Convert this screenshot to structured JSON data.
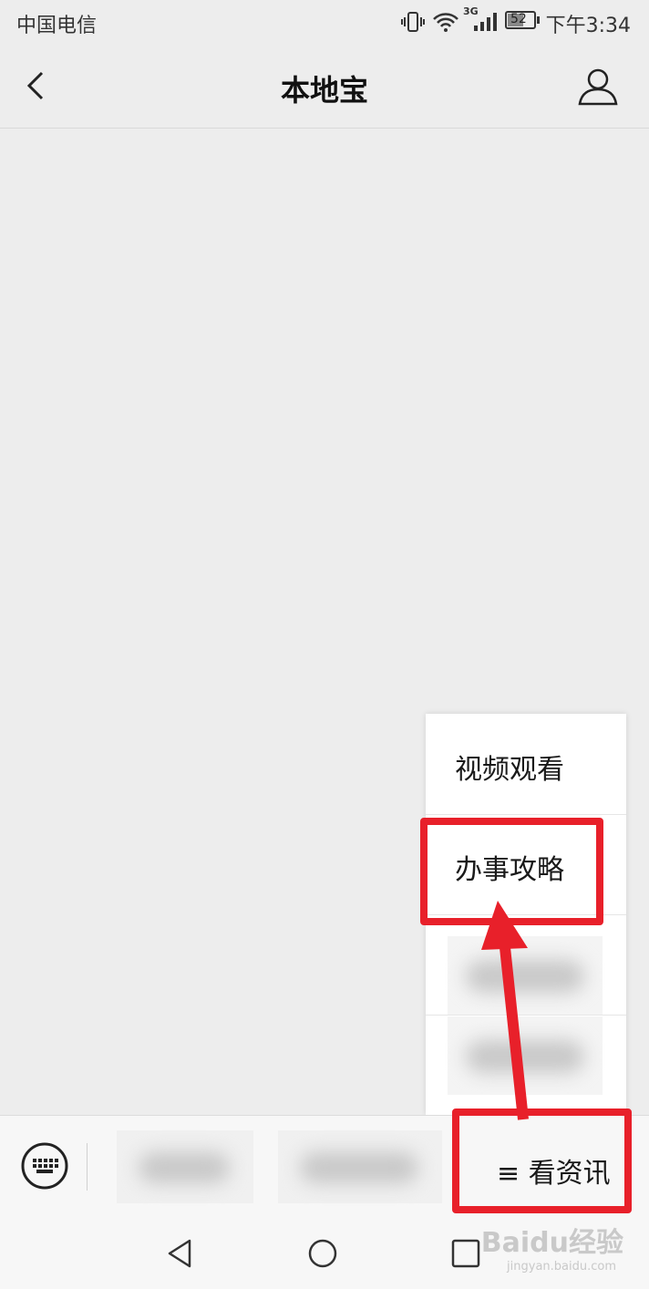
{
  "status_bar": {
    "carrier": "中国电信",
    "network": "3G",
    "battery": "52",
    "time": "下午3:34"
  },
  "header": {
    "title": "本地宝"
  },
  "popup_menu": {
    "items": [
      {
        "label": "视频观看"
      },
      {
        "label": "办事攻略"
      }
    ]
  },
  "menu_bar": {
    "news_tab_label": "≡ 看资讯"
  },
  "watermark": {
    "brand": "Baidu经验",
    "url": "jingyan.baidu.com"
  },
  "colors": {
    "annotation_red": "#e8202a",
    "background": "#ededed"
  },
  "icons": [
    "back-arrow-icon",
    "profile-icon",
    "keyboard-icon",
    "nav-back-icon",
    "nav-home-icon",
    "nav-recents-icon"
  ]
}
